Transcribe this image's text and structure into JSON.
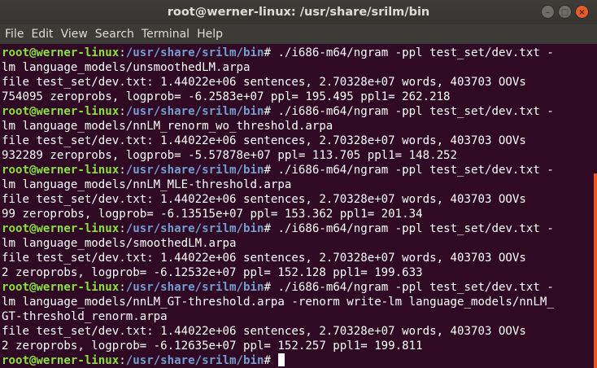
{
  "window": {
    "title": "root@werner-linux: /usr/share/srilm/bin"
  },
  "menu": [
    "File",
    "Edit",
    "View",
    "Search",
    "Terminal",
    "Help"
  ],
  "prompt": {
    "user": "root@werner-linux",
    "path": "/usr/share/srilm/bin",
    "symbol": "# "
  },
  "lines": [
    {
      "type": "cmd",
      "text": "./i686-m64/ngram -ppl test_set/dev.txt -"
    },
    {
      "type": "out",
      "text": "lm language_models/unsmoothedLM.arpa"
    },
    {
      "type": "out",
      "text": "file test_set/dev.txt: 1.44022e+06 sentences, 2.70328e+07 words, 403703 OOVs"
    },
    {
      "type": "out",
      "text": "754095 zeroprobs, logprob= -6.2583e+07 ppl= 195.495 ppl1= 262.218"
    },
    {
      "type": "cmd",
      "text": "./i686-m64/ngram -ppl test_set/dev.txt -"
    },
    {
      "type": "out",
      "text": "lm language_models/nnLM_renorm_wo_threshold.arpa"
    },
    {
      "type": "out",
      "text": "file test_set/dev.txt: 1.44022e+06 sentences, 2.70328e+07 words, 403703 OOVs"
    },
    {
      "type": "out",
      "text": "932289 zeroprobs, logprob= -5.57878e+07 ppl= 113.705 ppl1= 148.252"
    },
    {
      "type": "cmd",
      "text": "./i686-m64/ngram -ppl test_set/dev.txt -"
    },
    {
      "type": "out",
      "text": "lm language_models/nnLM_MLE-threshold.arpa"
    },
    {
      "type": "out",
      "text": "file test_set/dev.txt: 1.44022e+06 sentences, 2.70328e+07 words, 403703 OOVs"
    },
    {
      "type": "out",
      "text": "99 zeroprobs, logprob= -6.13515e+07 ppl= 153.362 ppl1= 201.34"
    },
    {
      "type": "cmd",
      "text": "./i686-m64/ngram -ppl test_set/dev.txt -"
    },
    {
      "type": "out",
      "text": "lm language_models/smoothedLM.arpa"
    },
    {
      "type": "out",
      "text": "file test_set/dev.txt: 1.44022e+06 sentences, 2.70328e+07 words, 403703 OOVs"
    },
    {
      "type": "out",
      "text": "2 zeroprobs, logprob= -6.12532e+07 ppl= 152.128 ppl1= 199.633"
    },
    {
      "type": "cmd",
      "text": "./i686-m64/ngram -ppl test_set/dev.txt -"
    },
    {
      "type": "out",
      "text": "lm language_models/nnLM_GT-threshold.arpa -renorm write-lm language_models/nnLM_"
    },
    {
      "type": "out",
      "text": "GT-threshold_renorm.arpa"
    },
    {
      "type": "out",
      "text": "file test_set/dev.txt: 1.44022e+06 sentences, 2.70328e+07 words, 403703 OOVs"
    },
    {
      "type": "out",
      "text": "2 zeroprobs, logprob= -6.12635e+07 ppl= 152.257 ppl1= 199.811"
    },
    {
      "type": "prompt",
      "text": ""
    }
  ],
  "colors": {
    "background": "#300a24",
    "user": "#8ae234",
    "path": "#729fcf",
    "scrollbar": "#e95420"
  },
  "scroll": {
    "thumb_start": 0.4,
    "thumb_fraction": 0.6
  }
}
